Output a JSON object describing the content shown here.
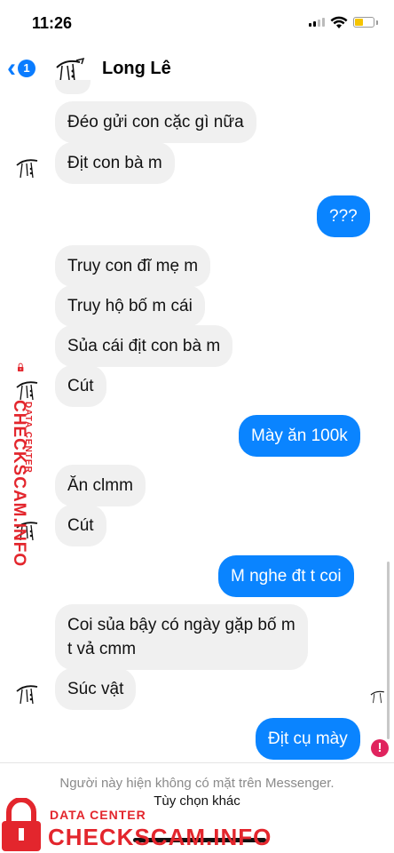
{
  "status": {
    "time": "11:26"
  },
  "header": {
    "back_count": "1",
    "contact_name": "Long Lê"
  },
  "messages": [
    {
      "text": "Đéo gửi con cặc gì nữa"
    },
    {
      "text": "Địt con bà m"
    },
    {
      "text": "???"
    },
    {
      "text": "Truy con đĩ mẹ m"
    },
    {
      "text": "Truy hộ bố m cái"
    },
    {
      "text": "Sủa cái địt con bà m"
    },
    {
      "text": "Cút"
    },
    {
      "text": "Mày ăn 100k"
    },
    {
      "text": "Ăn clmm"
    },
    {
      "text": "Cút"
    },
    {
      "text": "M nghe đt t coi"
    },
    {
      "text_line1": "Coi sủa bậy có ngày gặp bố m",
      "text_line2": "t vả cmm"
    },
    {
      "text": "Súc vật"
    },
    {
      "text": "Địt cụ mày"
    }
  ],
  "footer": {
    "notice": "Người này hiện không có mặt trên Messenger.",
    "options": "Tùy chọn khác"
  },
  "watermark": {
    "small": "DATA CENTER",
    "brand": "CHECKSCAM.INFO",
    "color": "#e3262d"
  },
  "colors": {
    "outgoing": "#0a84ff",
    "incoming": "#f0f0f0",
    "accent": "#0a7cff"
  }
}
